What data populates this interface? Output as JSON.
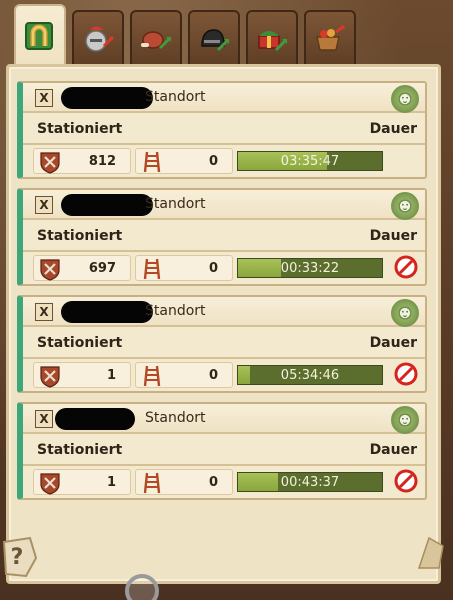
{
  "tabs": [
    {
      "name": "tab-overview",
      "active": true
    },
    {
      "name": "tab-knight",
      "active": false
    },
    {
      "name": "tab-food",
      "active": false
    },
    {
      "name": "tab-helmet",
      "active": false
    },
    {
      "name": "tab-gift",
      "active": false
    },
    {
      "name": "tab-basket",
      "active": false
    }
  ],
  "entries": [
    {
      "x_label": "X",
      "location_label": "Standort",
      "stationed_label": "Stationiert",
      "duration_label": "Dauer",
      "troops": "812",
      "ladders": "0",
      "timer": "03:35:47",
      "progress": 0.62,
      "cancellable": false
    },
    {
      "x_label": "X",
      "location_label": "Standort",
      "stationed_label": "Stationiert",
      "duration_label": "Dauer",
      "troops": "697",
      "ladders": "0",
      "timer": "00:33:22",
      "progress": 0.3,
      "cancellable": true
    },
    {
      "x_label": "X",
      "location_label": "Standort",
      "stationed_label": "Stationiert",
      "duration_label": "Dauer",
      "troops": "1",
      "ladders": "0",
      "timer": "05:34:46",
      "progress": 0.08,
      "cancellable": true
    },
    {
      "x_label": "X",
      "location_label": "Standort",
      "stationed_label": "Stationiert",
      "duration_label": "Dauer",
      "troops": "1",
      "ladders": "0",
      "timer": "00:43:37",
      "progress": 0.28,
      "cancellable": true
    }
  ],
  "help_label": "?",
  "colors": {
    "accent_stripe": "#3fa67a",
    "timer_fill": "#9ab54a",
    "cancel": "#d4241c"
  }
}
